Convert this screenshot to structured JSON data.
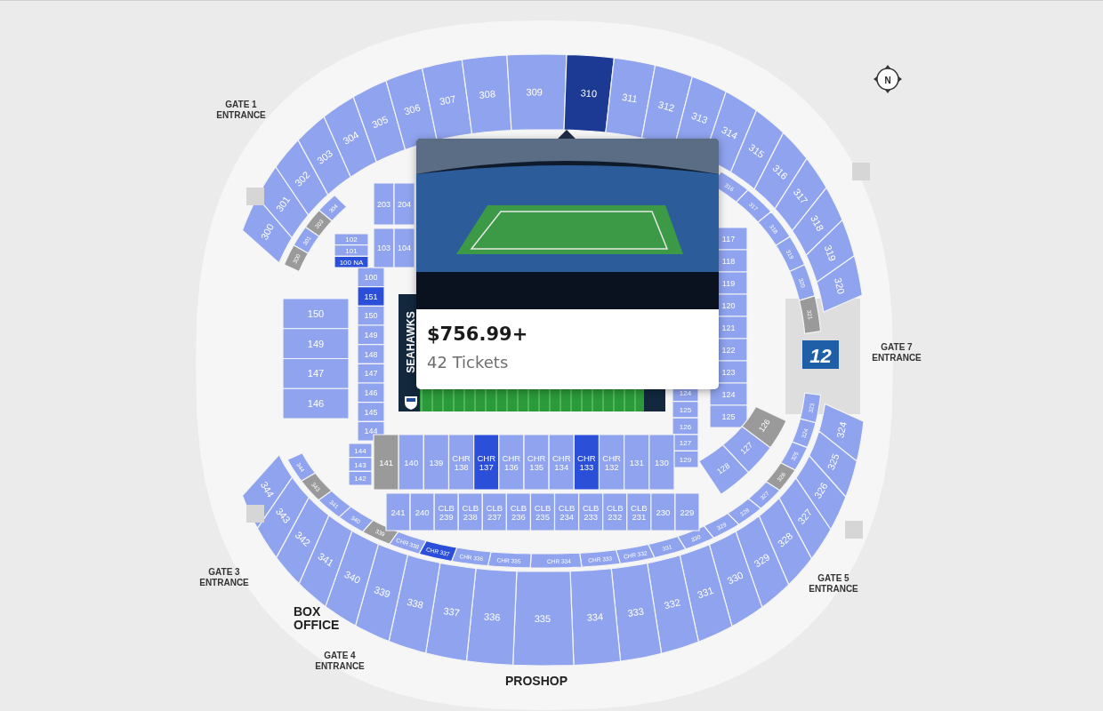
{
  "map": {
    "section_groups": [
      {
        "sections": [
          {
            "label": "300",
            "available": true,
            "selected": false
          },
          {
            "label": "301",
            "available": true,
            "selected": false
          },
          {
            "label": "302",
            "available": true,
            "selected": false
          },
          {
            "label": "303",
            "available": true,
            "selected": false
          },
          {
            "label": "304",
            "available": true,
            "selected": false
          },
          {
            "label": "305",
            "available": true,
            "selected": false
          },
          {
            "label": "306",
            "available": true,
            "selected": false
          },
          {
            "label": "307",
            "available": true,
            "selected": false
          },
          {
            "label": "308",
            "available": true,
            "selected": false
          },
          {
            "label": "309",
            "available": true,
            "selected": false
          },
          {
            "label": "310",
            "available": true,
            "selected": true
          },
          {
            "label": "311",
            "available": true,
            "selected": false
          },
          {
            "label": "312",
            "available": true,
            "selected": false
          },
          {
            "label": "313",
            "available": true,
            "selected": false
          },
          {
            "label": "314",
            "available": true,
            "selected": false
          },
          {
            "label": "315",
            "available": true,
            "selected": false
          },
          {
            "label": "316",
            "available": true,
            "selected": false
          },
          {
            "label": "317",
            "available": true,
            "selected": false
          },
          {
            "label": "318",
            "available": true,
            "selected": false
          },
          {
            "label": "319",
            "available": true,
            "selected": false
          },
          {
            "label": "320",
            "available": true,
            "selected": false
          }
        ]
      },
      {
        "sections": [
          {
            "label": "324",
            "available": true,
            "highlighted": false
          },
          {
            "label": "325",
            "available": true,
            "highlighted": false
          },
          {
            "label": "326",
            "available": true,
            "highlighted": false
          },
          {
            "label": "327",
            "available": true,
            "highlighted": false
          },
          {
            "label": "328",
            "available": true,
            "highlighted": false
          },
          {
            "label": "329",
            "available": true,
            "highlighted": false
          },
          {
            "label": "330",
            "available": true,
            "highlighted": false
          },
          {
            "label": "331",
            "available": true,
            "highlighted": false
          },
          {
            "label": "332",
            "available": true,
            "highlighted": false
          },
          {
            "label": "333",
            "available": true,
            "highlighted": false
          },
          {
            "label": "334",
            "available": true,
            "highlighted": false
          },
          {
            "label": "335",
            "available": true,
            "highlighted": false
          },
          {
            "label": "336",
            "available": true,
            "highlighted": false
          },
          {
            "label": "337",
            "available": true,
            "highlighted": false
          },
          {
            "label": "338",
            "available": true,
            "highlighted": false
          },
          {
            "label": "339",
            "available": true,
            "highlighted": false
          },
          {
            "label": "340",
            "available": true,
            "highlighted": false
          },
          {
            "label": "341",
            "available": true,
            "highlighted": false
          },
          {
            "label": "342",
            "available": true,
            "highlighted": false
          },
          {
            "label": "343",
            "available": true,
            "highlighted": false
          },
          {
            "label": "344",
            "available": true,
            "highlighted": false
          }
        ]
      },
      {
        "sections": [
          {
            "label": "300",
            "available": false,
            "highlighted": false
          },
          {
            "label": "301",
            "available": true,
            "highlighted": false
          },
          {
            "label": "303",
            "available": false,
            "highlighted": false
          },
          {
            "label": "304",
            "available": true,
            "highlighted": false
          }
        ]
      },
      {
        "sections": [
          {
            "label": "316",
            "available": true,
            "highlighted": false
          },
          {
            "label": "317",
            "available": true,
            "highlighted": false
          },
          {
            "label": "318",
            "available": true,
            "highlighted": false
          },
          {
            "label": "319",
            "available": true,
            "highlighted": false
          },
          {
            "label": "320",
            "available": true,
            "highlighted": false
          },
          {
            "label": "321",
            "available": false,
            "highlighted": false
          }
        ]
      },
      {
        "sections": [
          {
            "label": "323",
            "available": true,
            "highlighted": false
          },
          {
            "label": "324",
            "available": true,
            "highlighted": false
          },
          {
            "label": "325",
            "available": true,
            "highlighted": false
          },
          {
            "label": "326",
            "available": false,
            "highlighted": false
          },
          {
            "label": "327",
            "available": true,
            "highlighted": false
          },
          {
            "label": "328",
            "available": true,
            "highlighted": false
          },
          {
            "label": "329",
            "available": true,
            "highlighted": false
          },
          {
            "label": "330",
            "available": true,
            "highlighted": false
          },
          {
            "label": "331",
            "available": true,
            "highlighted": false
          },
          {
            "label": "CHR 332",
            "available": true,
            "highlighted": false
          },
          {
            "label": "CHR 333",
            "available": true,
            "highlighted": false
          },
          {
            "label": "CHR 334",
            "available": true,
            "highlighted": false
          },
          {
            "label": "CHR 335",
            "available": true,
            "highlighted": false
          },
          {
            "label": "CHR 336",
            "available": true,
            "highlighted": false
          },
          {
            "label": "CHR 337",
            "available": true,
            "highlighted": true
          },
          {
            "label": "CHR 338",
            "available": true,
            "highlighted": false
          },
          {
            "label": "339",
            "available": false,
            "highlighted": false
          },
          {
            "label": "340",
            "available": true,
            "highlighted": false
          },
          {
            "label": "341",
            "available": true,
            "highlighted": false
          },
          {
            "label": "343",
            "available": false,
            "highlighted": false
          },
          {
            "label": "344",
            "available": true,
            "highlighted": false
          }
        ]
      },
      {
        "sections": [
          {
            "label": "100",
            "available": true,
            "highlighted": false
          },
          {
            "label": "151",
            "available": true,
            "highlighted": true
          },
          {
            "label": "150",
            "available": true,
            "highlighted": false
          },
          {
            "label": "149",
            "available": true,
            "highlighted": false
          },
          {
            "label": "148",
            "available": true,
            "highlighted": false
          },
          {
            "label": "147",
            "available": true,
            "highlighted": false
          },
          {
            "label": "146",
            "available": true,
            "highlighted": false
          },
          {
            "label": "145",
            "available": true,
            "highlighted": false
          },
          {
            "label": "144",
            "available": true,
            "highlighted": false
          }
        ]
      },
      {
        "sections": [
          {
            "label": "150",
            "available": true,
            "highlighted": false
          },
          {
            "label": "149",
            "available": true,
            "highlighted": false
          },
          {
            "label": "147",
            "available": true,
            "highlighted": false
          },
          {
            "label": "146",
            "available": true,
            "highlighted": false
          }
        ]
      },
      {
        "sections": [
          {
            "label": "102",
            "available": true,
            "highlighted": false
          },
          {
            "label": "101",
            "available": true,
            "highlighted": false
          },
          {
            "label": "100 NA",
            "available": true,
            "highlighted": true
          }
        ]
      },
      {
        "sections": [
          {
            "label": "203",
            "available": true,
            "highlighted": false
          },
          {
            "label": "204",
            "available": true,
            "highlighted": false
          }
        ]
      },
      {
        "sections": [
          {
            "label": "103",
            "available": true,
            "highlighted": false
          },
          {
            "label": "104",
            "available": true,
            "highlighted": false
          }
        ]
      },
      {
        "sections": [
          {
            "label": "117",
            "available": true,
            "highlighted": false
          },
          {
            "label": "118",
            "available": true,
            "highlighted": false
          },
          {
            "label": "119",
            "available": true,
            "highlighted": false
          },
          {
            "label": "120",
            "available": true,
            "highlighted": false
          },
          {
            "label": "121",
            "available": true,
            "highlighted": false
          },
          {
            "label": "122",
            "available": true,
            "highlighted": false
          },
          {
            "label": "123",
            "available": true,
            "highlighted": false
          },
          {
            "label": "124",
            "available": true,
            "highlighted": false
          },
          {
            "label": "125",
            "available": true,
            "highlighted": false
          }
        ]
      },
      {
        "sections": [
          {
            "label": "126",
            "available": false,
            "highlighted": false
          },
          {
            "label": "127",
            "available": true,
            "highlighted": false
          },
          {
            "label": "128",
            "available": true,
            "highlighted": false
          }
        ]
      },
      {
        "sections": [
          {
            "label": "124",
            "available": true,
            "highlighted": false
          },
          {
            "label": "125",
            "available": true,
            "highlighted": false
          },
          {
            "label": "126",
            "available": true,
            "highlighted": false
          },
          {
            "label": "127",
            "available": true,
            "highlighted": false
          },
          {
            "label": "129",
            "available": true,
            "highlighted": false
          }
        ]
      },
      {
        "sections": [
          {
            "label": "144",
            "available": true,
            "highlighted": false
          },
          {
            "label": "143",
            "available": true,
            "highlighted": false
          },
          {
            "label": "142",
            "available": true,
            "highlighted": false
          }
        ]
      },
      {
        "sections": [
          {
            "label": "141",
            "available": false,
            "highlighted": false
          },
          {
            "label": "140",
            "available": true,
            "highlighted": false
          },
          {
            "label": "139",
            "available": true,
            "highlighted": false
          },
          {
            "label": "CHR 138",
            "available": true,
            "highlighted": false
          },
          {
            "label": "CHR 137",
            "available": true,
            "highlighted": true
          },
          {
            "label": "CHR 136",
            "available": true,
            "highlighted": false
          },
          {
            "label": "CHR 135",
            "available": true,
            "highlighted": false
          },
          {
            "label": "CHR 134",
            "available": true,
            "highlighted": false
          },
          {
            "label": "CHR 133",
            "available": true,
            "highlighted": true
          },
          {
            "label": "CHR 132",
            "available": true,
            "highlighted": false
          },
          {
            "label": "131",
            "available": true,
            "highlighted": false
          },
          {
            "label": "130",
            "available": true,
            "highlighted": false
          }
        ]
      },
      {
        "sections": [
          {
            "label": "241",
            "available": true,
            "highlighted": false
          },
          {
            "label": "240",
            "available": true,
            "highlighted": false
          },
          {
            "label": "CLB 239",
            "available": true,
            "highlighted": false
          },
          {
            "label": "CLB 238",
            "available": true,
            "highlighted": false
          },
          {
            "label": "CLB 237",
            "available": true,
            "highlighted": false
          },
          {
            "label": "CLB 236",
            "available": true,
            "highlighted": false
          },
          {
            "label": "CLB 235",
            "available": true,
            "highlighted": false
          },
          {
            "label": "CLB 234",
            "available": true,
            "highlighted": false
          },
          {
            "label": "CLB 233",
            "available": true,
            "highlighted": false
          },
          {
            "label": "CLB 232",
            "available": true,
            "highlighted": false
          },
          {
            "label": "CLB 231",
            "available": true,
            "highlighted": false
          },
          {
            "label": "230",
            "available": true,
            "highlighted": false
          },
          {
            "label": "229",
            "available": true,
            "highlighted": false
          }
        ]
      }
    ],
    "landmarks": [
      {
        "kind": "gate",
        "lines": [
          "GATE 1",
          "ENTRANCE"
        ]
      },
      {
        "kind": "gate",
        "lines": [
          "GATE 3",
          "ENTRANCE"
        ]
      },
      {
        "kind": "building",
        "lines": [
          "BOX",
          "OFFICE"
        ]
      },
      {
        "kind": "gate",
        "lines": [
          "GATE 4",
          "ENTRANCE"
        ]
      },
      {
        "kind": "building",
        "lines": [
          "PROSHOP"
        ]
      },
      {
        "kind": "gate",
        "lines": [
          "GATE 5",
          "ENTRANCE"
        ]
      },
      {
        "kind": "gate",
        "lines": [
          "GATE 7",
          "ENTRANCE"
        ]
      }
    ],
    "field": {
      "endzone_text": "SEAHAWKS"
    },
    "flag": {
      "text": "12"
    },
    "compass": {
      "text": "N"
    }
  },
  "popup": {
    "price": "$756.99+",
    "count": "42 Tickets"
  }
}
